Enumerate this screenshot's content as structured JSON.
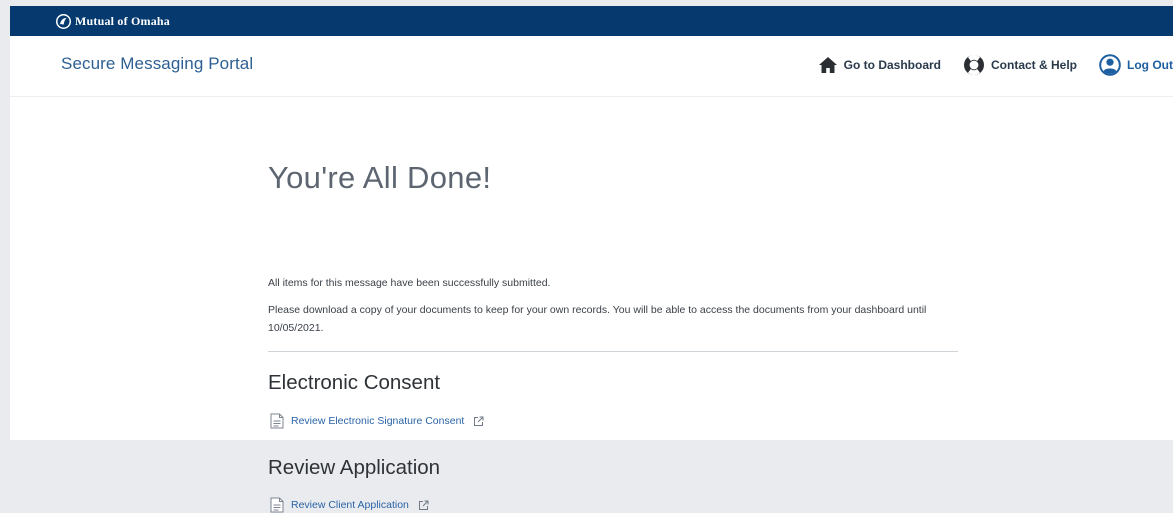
{
  "brand": {
    "logo_text": "Mutual of Omaha",
    "bar_color": "#063a6e"
  },
  "header": {
    "portal_title": "Secure Messaging Portal",
    "nav": {
      "dashboard_label": "Go to Dashboard",
      "help_label": "Contact & Help",
      "logout_label": "Log Out"
    }
  },
  "main": {
    "title": "You're All Done!",
    "submitted_text": "All items for this message have been successfully submitted.",
    "download_text": "Please download a copy of your documents to keep for your own records. You will be able to access the documents from your dashboard until 10/05/2021.",
    "sections": [
      {
        "title": "Electronic Consent",
        "link_label": "Review Electronic Signature Consent"
      },
      {
        "title": "Review Application",
        "link_label": "Review Client Application"
      }
    ]
  },
  "icons": {
    "dashboard": "home-icon",
    "help": "lifebuoy-icon",
    "logout": "user-circle-icon",
    "document": "document-icon",
    "external": "external-link-icon"
  },
  "colors": {
    "link": "#2a64a6",
    "portal_title": "#2e5f92",
    "page_background": "#e9ebee"
  }
}
